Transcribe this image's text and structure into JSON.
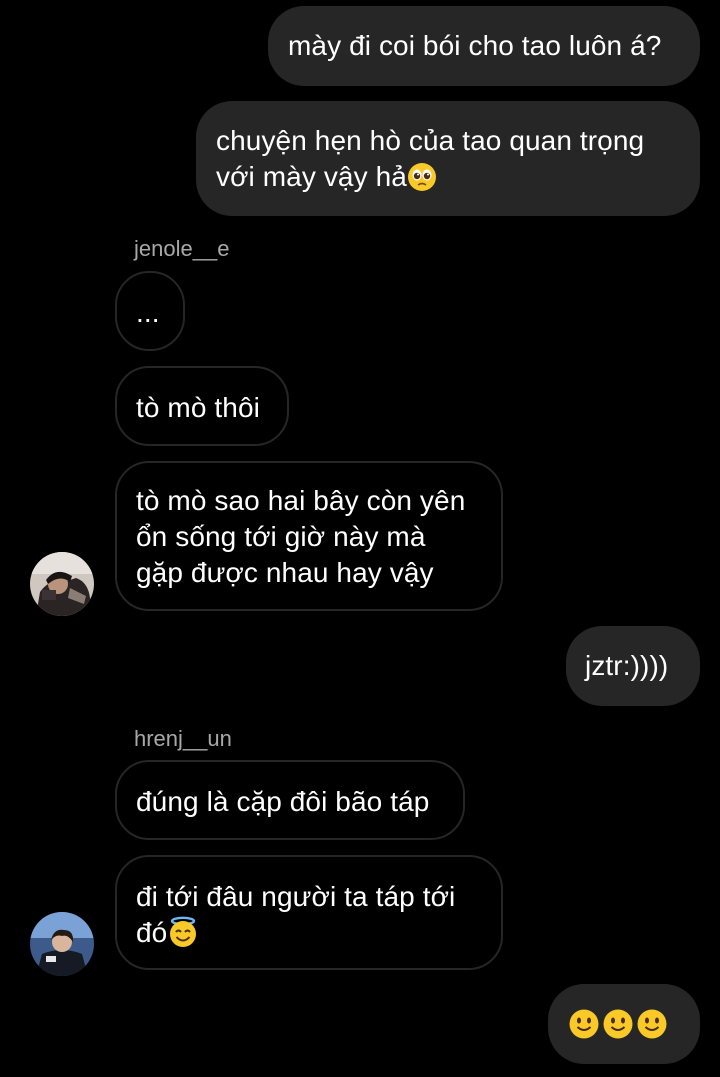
{
  "messages": {
    "m1": "mày đi coi bói cho tao luôn á?",
    "m2_line1": "chuyện hẹn hò của tao quan trọng",
    "m2_line2": "với mày vậy hả",
    "m3": "...",
    "m4": "tò mò thôi",
    "m5_line1": "tò mò sao hai bây còn yên",
    "m5_line2": "ổn sống tới giờ này mà",
    "m5_line3": "gặp được nhau hay vậy",
    "m6": "jztr:))))",
    "m7": "đúng là cặp đôi bão táp",
    "m8_line1": "đi tới đâu người ta táp tới",
    "m8_line2": "đó"
  },
  "senders": {
    "s1": "jenole__e",
    "s2": "hrenj__un"
  },
  "icons": {
    "pleading": "pleading-face-emoji",
    "halo": "smiling-face-with-halo-emoji",
    "smile": "slightly-smiling-face-emoji"
  },
  "colors": {
    "background": "#000000",
    "outgoing_bubble": "#262626",
    "incoming_border": "#262626",
    "sender_text": "#a8a8a8"
  }
}
